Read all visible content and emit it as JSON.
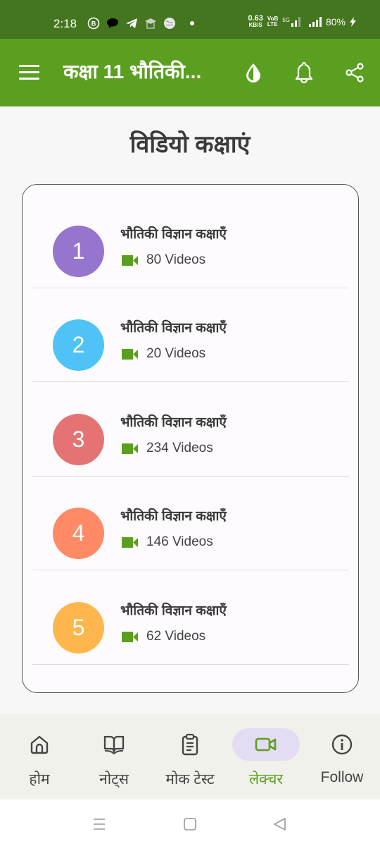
{
  "status_bar": {
    "time": "2:18",
    "left_icons": [
      "whatsapp-business-icon",
      "chat-bubble-icon",
      "telegram-icon",
      "education-app-icon",
      "browser-app-icon",
      "notification-dot-icon"
    ],
    "net_speed_value": "0.63",
    "net_speed_unit": "KB/S",
    "volte_top": "VoB",
    "volte_bottom": "LTE",
    "network_type": "5G",
    "battery": "80%",
    "charging_icon": "bolt-icon"
  },
  "app_bar": {
    "menu_icon": "hamburger-menu-icon",
    "title": "कक्षा 11 भौतिकी...",
    "actions": [
      "theme-toggle-icon",
      "bell-icon",
      "share-icon"
    ]
  },
  "page": {
    "heading": "विडियो कक्षाएं"
  },
  "lectures": [
    {
      "number": "1",
      "title": "भौतिकी विज्ञान कक्षाएँ",
      "videos": "80 Videos",
      "color": "#9575cd"
    },
    {
      "number": "2",
      "title": "भौतिकी विज्ञान कक्षाएँ",
      "videos": "20 Videos",
      "color": "#4fc3f7"
    },
    {
      "number": "3",
      "title": "भौतिकी विज्ञान कक्षाएँ",
      "videos": "234 Videos",
      "color": "#e57373"
    },
    {
      "number": "4",
      "title": "भौतिकी विज्ञान कक्षाएँ",
      "videos": "146 Videos",
      "color": "#ff8a65"
    },
    {
      "number": "5",
      "title": "भौतिकी विज्ञान कक्षाएँ",
      "videos": "62 Videos",
      "color": "#ffb74d"
    }
  ],
  "bottom_nav": {
    "items": [
      {
        "label": "होम",
        "icon": "home-icon",
        "active": false
      },
      {
        "label": "नोट्स",
        "icon": "book-icon",
        "active": false
      },
      {
        "label": "मोक टेस्ट",
        "icon": "clipboard-icon",
        "active": false
      },
      {
        "label": "लेक्चर",
        "icon": "video-camera-icon",
        "active": true
      },
      {
        "label": "Follow",
        "icon": "info-icon",
        "active": false
      }
    ]
  },
  "colors": {
    "status_bar": "#44761f",
    "app_bar": "#5b9f20",
    "accent": "#5b9f20",
    "active_nav_pill": "#e4dcf2"
  }
}
